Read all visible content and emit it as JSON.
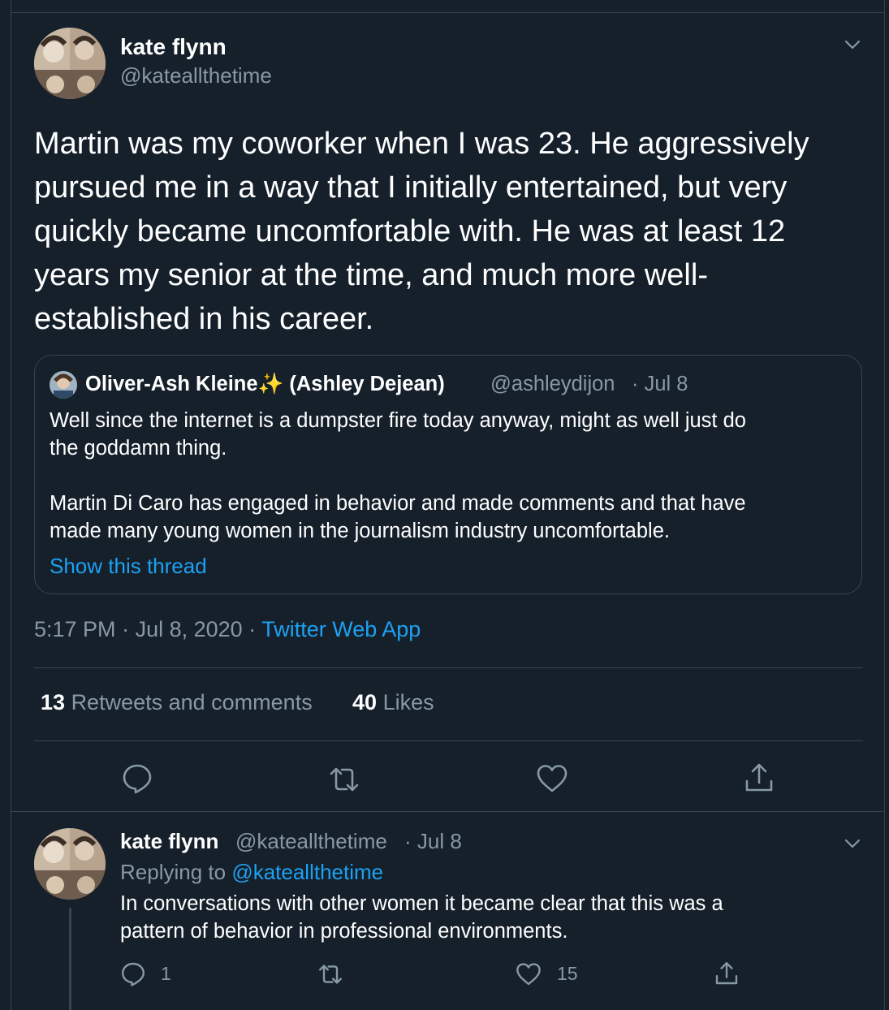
{
  "main_tweet": {
    "author_name": "kate flynn",
    "author_handle": "@kateallthetime",
    "text_lines": [
      "Martin was my coworker when I was 23. He aggressively",
      "pursued me in a way that I initially entertained, but very",
      "quickly became uncomfortable with. He was at least 12",
      "years my senior at the time, and much more well-",
      "established in his career."
    ],
    "quoted": {
      "author_name": "Oliver-Ash Kleine✨ (Ashley Dejean)",
      "author_handle": "@ashleydijon",
      "date": "· Jul 8",
      "text_lines": [
        "Well since the internet is a dumpster fire today anyway, might as well just do",
        "the goddamn thing.",
        "Martin Di Caro has engaged in behavior and made comments and that have",
        "made many young women in the journalism industry uncomfortable."
      ],
      "show_thread": "Show this thread"
    },
    "time": "5:17 PM",
    "date": "Jul 8, 2020",
    "sep": "·",
    "source": "Twitter Web App",
    "retweets_count": "13",
    "retweets_label": "Retweets and comments",
    "likes_count": "40",
    "likes_label": "Likes"
  },
  "reply": {
    "author_name": "kate flynn",
    "author_handle": "@kateallthetime",
    "date": "· Jul 8",
    "replying_to_label": "Replying to",
    "replying_to_handle": "@kateallthetime",
    "text_lines": [
      "In conversations with other women it became clear that this was a",
      "pattern of behavior in professional environments."
    ],
    "reply_count": "1",
    "like_count": "15"
  },
  "icons": {
    "main_actions": [
      "reply-icon",
      "retweet-icon",
      "like-icon",
      "share-icon"
    ],
    "reply_actions": [
      "reply-icon",
      "retweet-icon",
      "like-icon",
      "share-icon"
    ],
    "menu": "chevron-down-icon"
  },
  "colors": {
    "background": "#15202b",
    "border": "#38444d",
    "secondary_text": "#8899a6",
    "accent": "#1da1f2"
  }
}
